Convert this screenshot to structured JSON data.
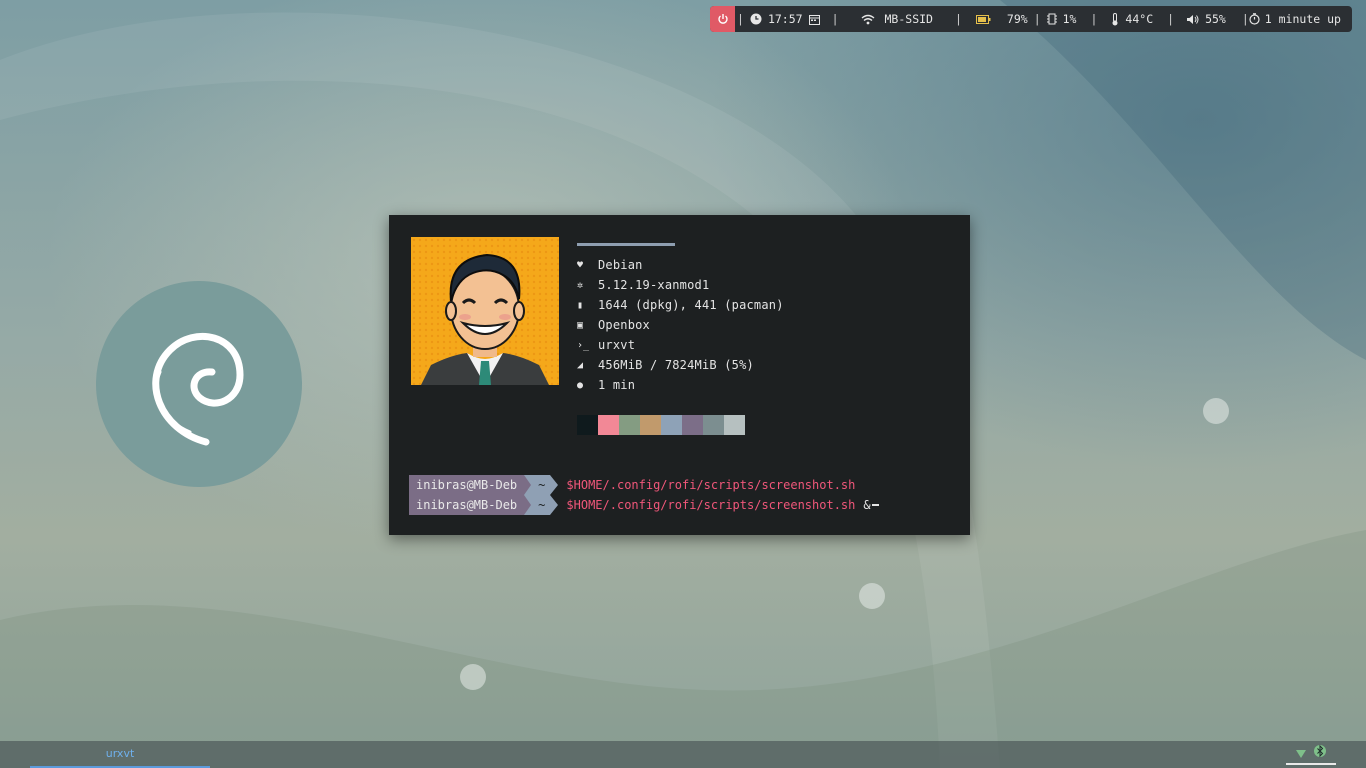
{
  "statusbar": {
    "time": "17:57",
    "wifi_ssid": "MB-SSID",
    "battery": "79%",
    "cpu": "1%",
    "temperature": "44°C",
    "volume": "55%",
    "uptime": "1 minute up",
    "separator": "|",
    "power_color": "#e05a66"
  },
  "terminal": {
    "info": [
      {
        "icon": "heart-icon",
        "value": "Debian"
      },
      {
        "icon": "gear-icon",
        "value": "5.12.19-xanmod1"
      },
      {
        "icon": "package-icon",
        "value": "1644 (dpkg), 441 (pacman)"
      },
      {
        "icon": "window-icon",
        "value": "Openbox"
      },
      {
        "icon": "terminal-icon",
        "value": "urxvt"
      },
      {
        "icon": "memory-icon",
        "value": "456MiB / 7824MiB (5%)"
      },
      {
        "icon": "bulb-icon",
        "value": "1 min"
      }
    ],
    "palette": [
      "#0f1a1d",
      "#f28896",
      "#849c82",
      "#c19a6c",
      "#8ea2b7",
      "#7c6e88",
      "#7c8e90",
      "#b6c0c0"
    ],
    "prompts": [
      {
        "user": "inibras@MB-Deb",
        "dir": "~",
        "command": "$HOME/.config/rofi/scripts/screenshot.sh",
        "suffix": ""
      },
      {
        "user": "inibras@MB-Deb",
        "dir": "~",
        "command": "$HOME/.config/rofi/scripts/screenshot.sh",
        "suffix": "&"
      }
    ]
  },
  "taskbar": {
    "task_label": "urxvt",
    "accent": "#5b9bdc"
  }
}
